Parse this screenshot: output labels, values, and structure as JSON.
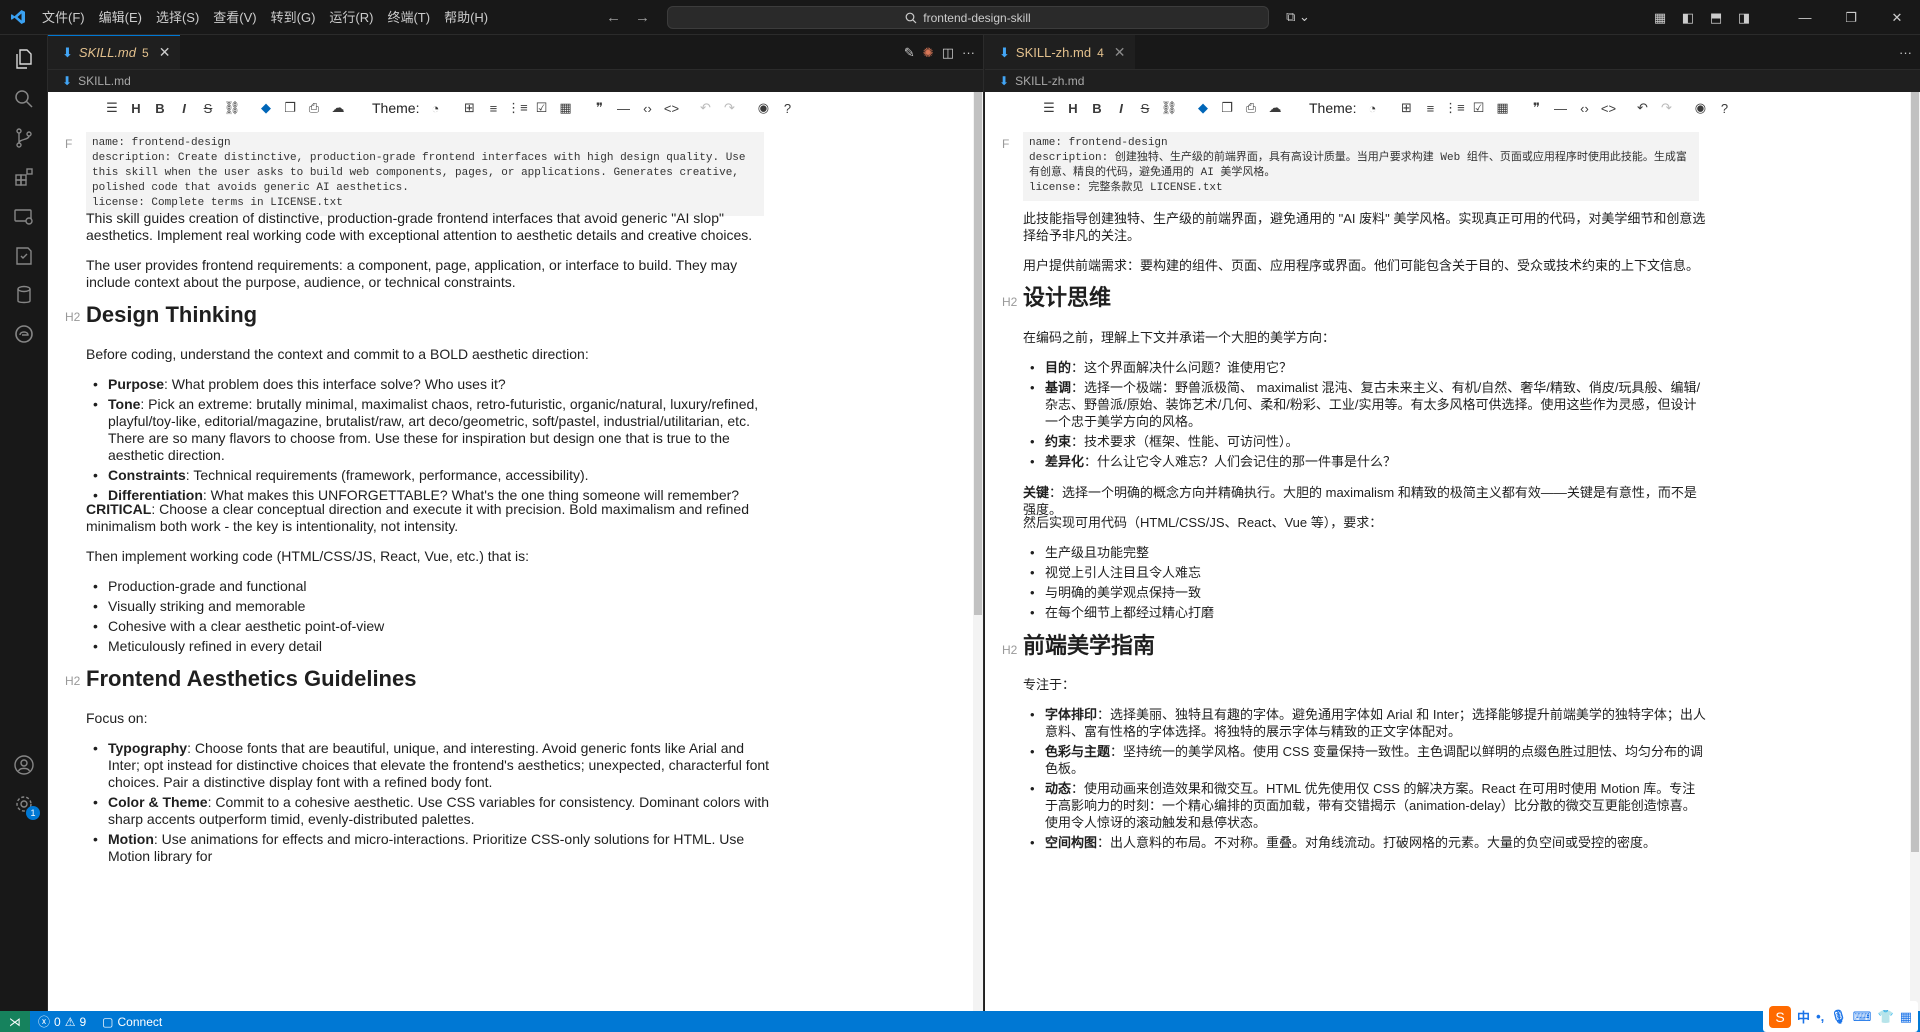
{
  "menu": [
    "文件(F)",
    "编辑(E)",
    "选择(S)",
    "查看(V)",
    "转到(G)",
    "运行(R)",
    "终端(T)",
    "帮助(H)"
  ],
  "search": {
    "text": "frontend-design-skill"
  },
  "activity_badge": "1",
  "left": {
    "tab": {
      "label": "SKILL.md",
      "count": "5"
    },
    "breadcrumb": "SKILL.md",
    "toolbar": {
      "theme_label": "Theme:"
    },
    "frontmatter_tag": "F",
    "frontmatter": "name: frontend-design\ndescription: Create distinctive, production-grade frontend interfaces with high design quality. Use this skill when the user asks to build web components, pages, or applications. Generates creative, polished code that avoids generic AI aesthetics.\nlicense: Complete terms in LICENSE.txt",
    "intro1": "This skill guides creation of distinctive, production-grade frontend interfaces that avoid generic \"AI slop\" aesthetics. Implement real working code with exceptional attention to aesthetic details and creative choices.",
    "intro2": "The user provides frontend requirements: a component, page, application, or interface to build. They may include context about the purpose, audience, or technical constraints.",
    "h2_tag": "H2",
    "h2_design": "Design Thinking",
    "design_intro": "Before coding, understand the context and commit to a BOLD aesthetic direction:",
    "design_items": [
      {
        "bold": "Purpose",
        "text": ": What problem does this interface solve? Who uses it?"
      },
      {
        "bold": "Tone",
        "text": ": Pick an extreme: brutally minimal, maximalist chaos, retro-futuristic, organic/natural, luxury/refined, playful/toy-like, editorial/magazine, brutalist/raw, art deco/geometric, soft/pastel, industrial/utilitarian, etc. There are so many flavors to choose from. Use these for inspiration but design one that is true to the aesthetic direction."
      },
      {
        "bold": "Constraints",
        "text": ": Technical requirements (framework, performance, accessibility)."
      },
      {
        "bold": "Differentiation",
        "text": ": What makes this UNFORGETTABLE? What's the one thing someone will remember?"
      }
    ],
    "critical_bold": "CRITICAL",
    "critical_text": ": Choose a clear conceptual direction and execute it with precision. Bold maximalism and refined minimalism both work - the key is intentionality, not intensity.",
    "implement_intro": "Then implement working code (HTML/CSS/JS, React, Vue, etc.) that is:",
    "implement_items": [
      "Production-grade and functional",
      "Visually striking and memorable",
      "Cohesive with a clear aesthetic point-of-view",
      "Meticulously refined in every detail"
    ],
    "h2_aesthetics": "Frontend Aesthetics Guidelines",
    "focus": "Focus on:",
    "aesthetic_items": [
      {
        "bold": "Typography",
        "text": ": Choose fonts that are beautiful, unique, and interesting. Avoid generic fonts like Arial and Inter; opt instead for distinctive choices that elevate the frontend's aesthetics; unexpected, characterful font choices. Pair a distinctive display font with a refined body font."
      },
      {
        "bold": "Color & Theme",
        "text": ": Commit to a cohesive aesthetic. Use CSS variables for consistency. Dominant colors with sharp accents outperform timid, evenly-distributed palettes."
      },
      {
        "bold": "Motion",
        "text": ": Use animations for effects and micro-interactions. Prioritize CSS-only solutions for HTML. Use Motion library for"
      }
    ]
  },
  "right": {
    "tab": {
      "label": "SKILL-zh.md",
      "count": "4"
    },
    "breadcrumb": "SKILL-zh.md",
    "toolbar": {
      "theme_label": "Theme:"
    },
    "frontmatter_tag": "F",
    "frontmatter": "name: frontend-design\ndescription: 创建独特、生产级的前端界面，具有高设计质量。当用户要求构建 Web 组件、页面或应用程序时使用此技能。生成富有创意、精良的代码，避免通用的 AI 美学风格。\nlicense: 完整条款见 LICENSE.txt",
    "intro1": "此技能指导创建独特、生产级的前端界面，避免通用的 \"AI 废料\" 美学风格。实现真正可用的代码，对美学细节和创意选择给予非凡的关注。",
    "intro2": "用户提供前端需求：要构建的组件、页面、应用程序或界面。他们可能包含关于目的、受众或技术约束的上下文信息。",
    "h2_tag": "H2",
    "h2_design": "设计思维",
    "design_intro": "在编码之前，理解上下文并承诺一个大胆的美学方向：",
    "design_items": [
      {
        "bold": "目的",
        "text": "：这个界面解决什么问题？谁使用它？"
      },
      {
        "bold": "基调",
        "text": "：选择一个极端：野兽派极简、 maximalist 混沌、复古未来主义、有机/自然、奢华/精致、俏皮/玩具般、编辑/杂志、野兽派/原始、装饰艺术/几何、柔和/粉彩、工业/实用等。有太多风格可供选择。使用这些作为灵感，但设计一个忠于美学方向的风格。"
      },
      {
        "bold": "约束",
        "text": "：技术要求（框架、性能、可访问性）。"
      },
      {
        "bold": "差异化",
        "text": "：什么让它令人难忘？人们会记住的那一件事是什么？"
      }
    ],
    "critical_bold": "关键",
    "critical_text": "：选择一个明确的概念方向并精确执行。大胆的 maximalism 和精致的极简主义都有效——关键是有意性，而不是强度。",
    "implement_intro": "然后实现可用代码（HTML/CSS/JS、React、Vue 等），要求：",
    "implement_items": [
      "生产级且功能完整",
      "视觉上引人注目且令人难忘",
      "与明确的美学观点保持一致",
      "在每个细节上都经过精心打磨"
    ],
    "h2_aesthetics": "前端美学指南",
    "focus": "专注于：",
    "aesthetic_items": [
      {
        "bold": "字体排印",
        "text": "：选择美丽、独特且有趣的字体。避免通用字体如 Arial 和 Inter；选择能够提升前端美学的独特字体；出人意料、富有性格的字体选择。将独特的展示字体与精致的正文字体配对。"
      },
      {
        "bold": "色彩与主题",
        "text": "：坚持统一的美学风格。使用 CSS 变量保持一致性。主色调配以鲜明的点缀色胜过胆怯、均匀分布的调色板。"
      },
      {
        "bold": "动态",
        "text": "：使用动画来创造效果和微交互。HTML 优先使用仅 CSS 的解决方案。React 在可用时使用 Motion 库。专注于高影响力的时刻：一个精心编排的页面加载，带有交错揭示（animation-delay）比分散的微交互更能创造惊喜。使用令人惊讶的滚动触发和悬停状态。"
      },
      {
        "bold": "空间构图",
        "text": "：出人意料的布局。不对称。重叠。对角线流动。打破网格的元素。大量的负空间或受控的密度。"
      }
    ]
  },
  "status": {
    "errors": "0",
    "warnings": "9",
    "connect": "Connect"
  },
  "ime": {
    "lang": "中"
  }
}
